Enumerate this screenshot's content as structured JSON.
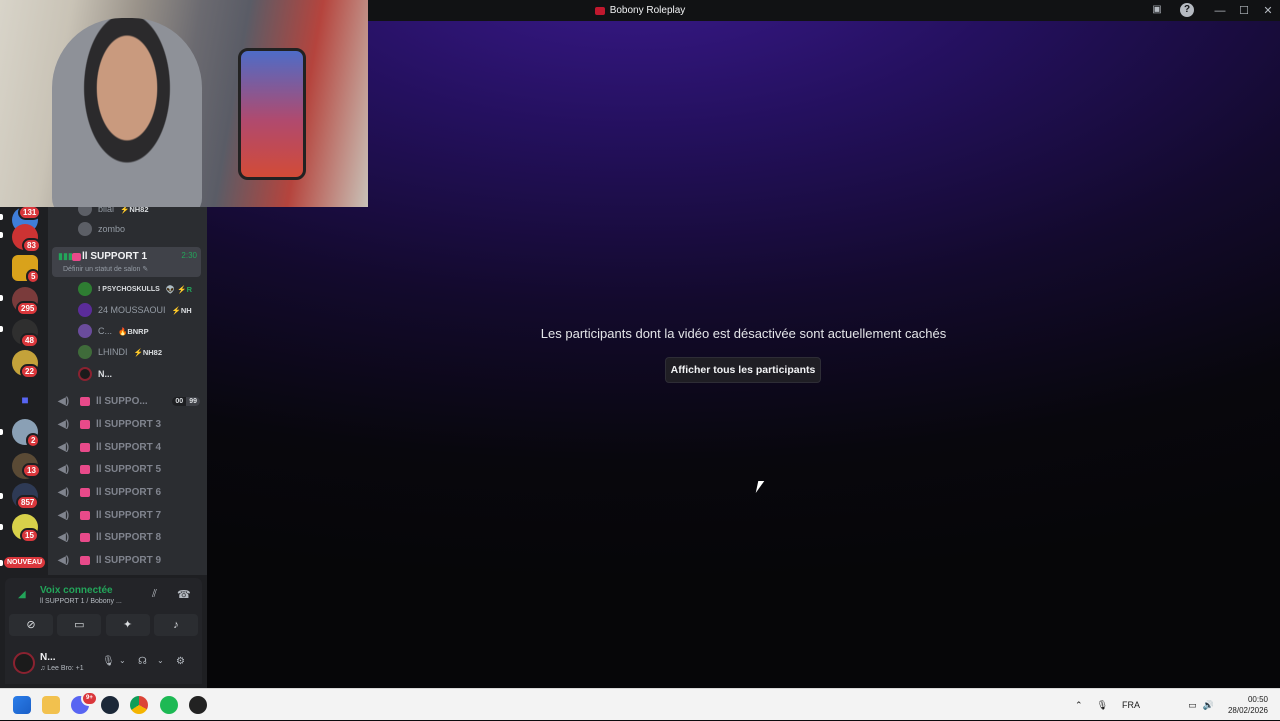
{
  "window": {
    "title": "Bobony Roleplay"
  },
  "servers": [
    {
      "name": "server-1",
      "badge": "131",
      "color": "#3f7ed9"
    },
    {
      "name": "server-2",
      "badge": "83",
      "color": "#cc3333"
    },
    {
      "name": "server-3",
      "badge": "5",
      "color": "#d9a21b"
    },
    {
      "name": "server-4",
      "badge": "295",
      "color": "#7a3b3b"
    },
    {
      "name": "server-5",
      "badge": "48",
      "color": "#2f2f2f"
    },
    {
      "name": "server-6",
      "badge": "22",
      "color": "#c4a23a"
    },
    {
      "name": "server-7",
      "badge": "2",
      "color": "#8aa0b5"
    },
    {
      "name": "server-8",
      "badge": "13",
      "color": "#5a4a35"
    },
    {
      "name": "server-9",
      "badge": "857",
      "color": "#2e3a55"
    },
    {
      "name": "server-10",
      "badge": "15",
      "color": "#d8d14a"
    }
  ],
  "server_rail": {
    "new_label": "NOUVEAU"
  },
  "channels": {
    "top_members": [
      {
        "name": "bilal",
        "tag": "⚡NH82"
      },
      {
        "name": "zombo",
        "tag": ""
      }
    ],
    "active_channel": {
      "name": "ll SUPPORT 1",
      "timer": "2:30",
      "status": "Définir un statut de salon ✎",
      "members": [
        {
          "name": "! PSYCHOSKULLS",
          "tag": "👽 ⚡R"
        },
        {
          "name": "24 MOUSSAOUI",
          "tag": "⚡NH"
        },
        {
          "name": "C...",
          "tag": "🔥BNRP"
        },
        {
          "name": "LHINDI",
          "tag": "⚡NH82"
        },
        {
          "name": "N...",
          "tag": ""
        }
      ]
    },
    "voice_channels": [
      {
        "name": "ll SUPPO...",
        "count_a": "00",
        "count_b": "99"
      },
      {
        "name": "ll SUPPORT 3"
      },
      {
        "name": "ll SUPPORT 4"
      },
      {
        "name": "ll SUPPORT 5"
      },
      {
        "name": "ll SUPPORT 6"
      },
      {
        "name": "ll SUPPORT 7"
      },
      {
        "name": "ll SUPPORT 8"
      },
      {
        "name": "ll SUPPORT 9"
      }
    ]
  },
  "voice_panel": {
    "title": "Voix connectée",
    "subtitle": "ll SUPPORT 1 / Bobony ..."
  },
  "user_panel": {
    "username": "N...",
    "activity": "♫ Lee Bro: +1"
  },
  "stage": {
    "message": "Les participants dont la vidéo est désactivée sont actuellement cachés",
    "show_button": "Afficher tous les participants"
  },
  "taskbar": {
    "language": "FRA",
    "time": "00:50",
    "date": "28/02/2026",
    "discord_badge": "9+"
  }
}
